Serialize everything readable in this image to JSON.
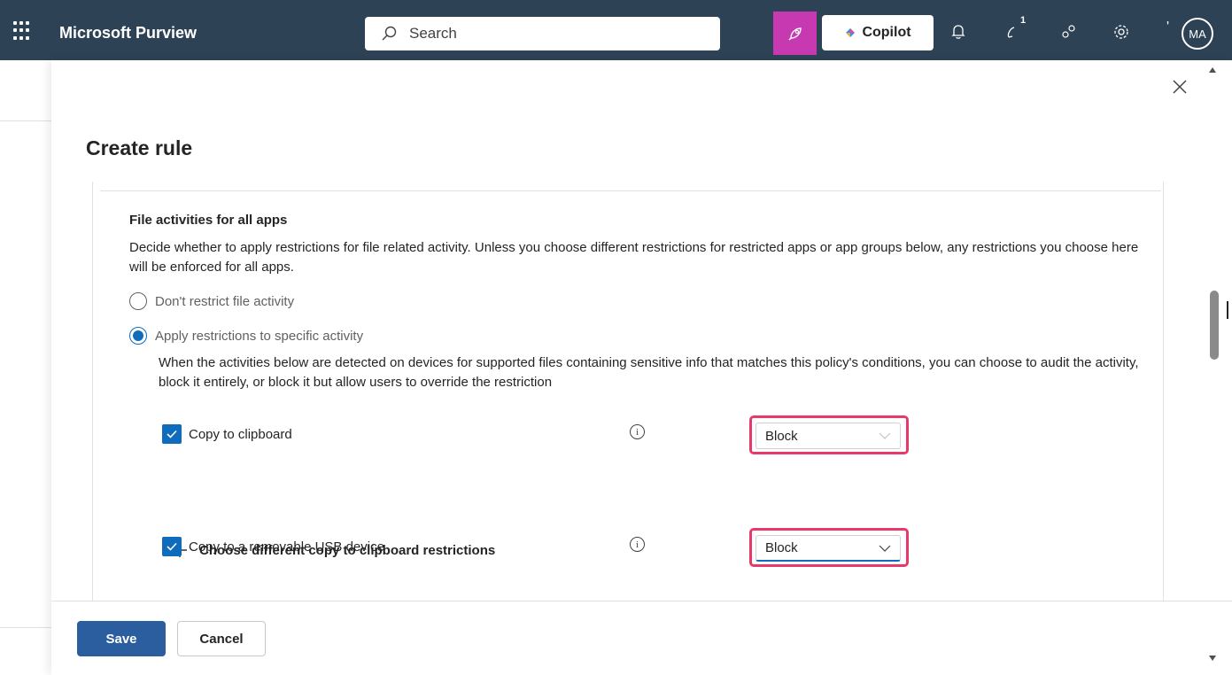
{
  "topbar": {
    "app_title": "Microsoft Purview",
    "search_placeholder": "Search",
    "copilot_label": "Copilot",
    "notification_count": "1",
    "avatar_initials": "MA",
    "pink_button_color": "#c739b0",
    "icons": [
      "app-launcher-icon",
      "search-icon",
      "rocket-icon",
      "copilot-icon",
      "bell-icon",
      "lightbulb-icon",
      "share-icon",
      "settings-icon"
    ]
  },
  "panel": {
    "title": "Create rule",
    "section": {
      "title": "File activities for all apps",
      "description": "Decide whether to apply restrictions for file related activity. Unless you choose different restrictions for restricted apps or app groups below, any restrictions you choose here will be enforced for all apps.",
      "options": [
        {
          "label": "Don't restrict file activity",
          "selected": false
        },
        {
          "label": "Apply restrictions to specific activity",
          "selected": true
        }
      ],
      "activity_description": "When the activities below are detected on devices for supported files containing sensitive info that matches this policy's conditions, you can choose to audit the activity, block it entirely, or block it but allow users to override the restriction",
      "activities": [
        {
          "label": "Copy to clipboard",
          "checked": true,
          "action": "Block",
          "add_restrictions_label": "Choose different copy to clipboard restrictions"
        },
        {
          "label": "Copy to a removable USB device",
          "checked": true,
          "action": "Block"
        }
      ]
    }
  },
  "footer": {
    "save_label": "Save",
    "cancel_label": "Cancel"
  },
  "colors": {
    "topbar": "#2e4256",
    "accent": "#0f6cbd",
    "highlight": "#e8396a",
    "save_button": "#2b5e9e"
  }
}
